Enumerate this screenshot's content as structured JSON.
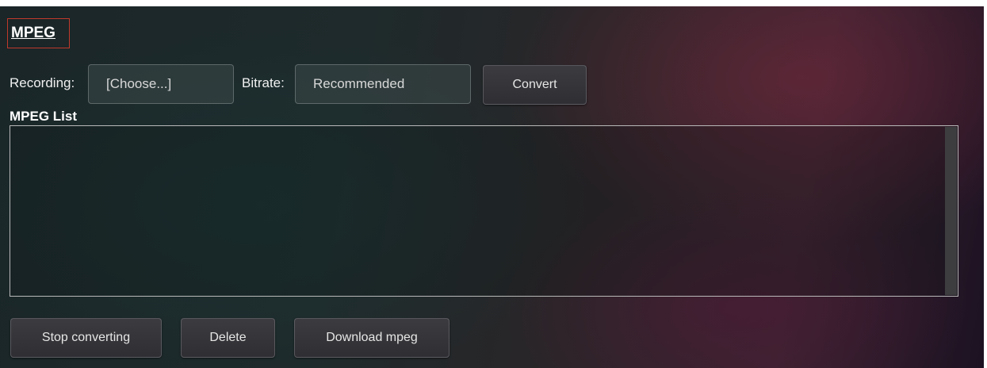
{
  "header": {
    "title": "MPEG"
  },
  "form": {
    "recording_label": "Recording:",
    "recording_value": "[Choose...]",
    "bitrate_label": "Bitrate:",
    "bitrate_value": "Recommended",
    "convert_label": "Convert"
  },
  "list": {
    "label": "MPEG List",
    "items": []
  },
  "actions": {
    "stop_label": "Stop converting",
    "delete_label": "Delete",
    "download_label": "Download mpeg"
  },
  "colors": {
    "title_box_border": "#c0392b",
    "listbox_border": "#b8b8b8"
  }
}
